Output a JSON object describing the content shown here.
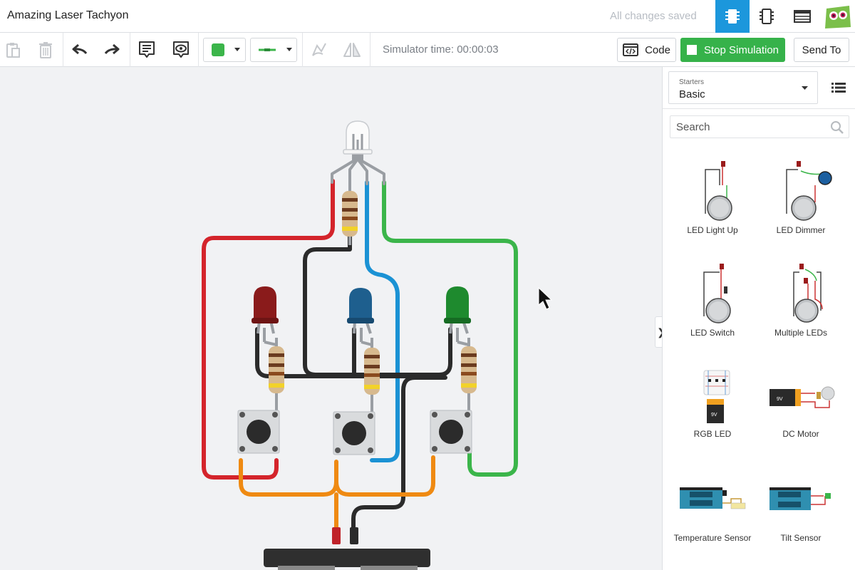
{
  "app": {
    "title": "Amazing Laser Tachyon",
    "save_status": "All changes saved"
  },
  "toolbar": {
    "simulator_time": "Simulator time: 00:00:03",
    "code_label": "Code",
    "stop_label": "Stop Simulation",
    "send_label": "Send To",
    "fill_color": "#3bb54a",
    "wire_color": "#3bb54a"
  },
  "sidebar": {
    "starters_label": "Starters",
    "starters_value": "Basic",
    "search_placeholder": "Search",
    "components": [
      {
        "label": "LED Light Up"
      },
      {
        "label": "LED Dimmer"
      },
      {
        "label": "LED Switch"
      },
      {
        "label": "Multiple LEDs"
      },
      {
        "label": "RGB LED"
      },
      {
        "label": "DC Motor"
      },
      {
        "label": "Temperature Sensor"
      },
      {
        "label": "Tilt Sensor"
      }
    ]
  },
  "colors": {
    "accent": "#1c97dc",
    "run_green": "#36b24a",
    "wire_red": "#d4242b",
    "wire_blue": "#1b92d4",
    "wire_green": "#3bb54a",
    "wire_black": "#2b2b2b",
    "wire_orange": "#ef8a12",
    "led_red": "#8a1b1b",
    "led_blue": "#1e5f8e",
    "led_green": "#1e8a2e"
  }
}
